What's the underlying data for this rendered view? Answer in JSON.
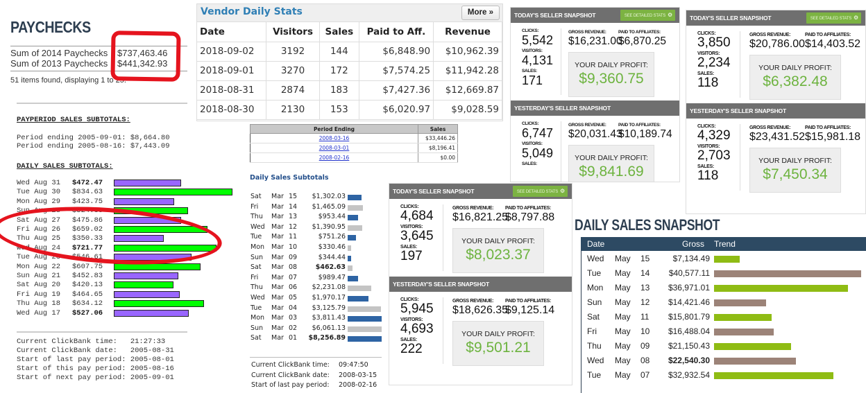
{
  "paychecks": {
    "title": "PAYCHECKS",
    "sums": [
      {
        "label": "Sum of 2014 Paychecks",
        "value": "$737,463.46"
      },
      {
        "label": "Sum of 2013 Paychecks",
        "value": "$441,342.93"
      }
    ],
    "items_found": "51 items found, displaying 1 to 25."
  },
  "clickbank_2005": {
    "payperiod_header": "PAYPERIOD SALES SUBTOTALS:",
    "periods": [
      "Period ending 2005-09-01: $8,664.80",
      "Period ending 2005-08-16: $7,443.09"
    ],
    "daily_header": "DAILY SALES SUBTOTALS:",
    "daily": [
      {
        "label": "Wed Aug 31",
        "value": "$472.47",
        "amount": 472.47,
        "bold": true,
        "color": "#9966ff"
      },
      {
        "label": "Tue Aug 30",
        "value": "$834.63",
        "amount": 834.63,
        "bold": false,
        "color": "#00ff00"
      },
      {
        "label": "Mon Aug 29",
        "value": "$423.75",
        "amount": 423.75,
        "bold": false,
        "color": "#9966ff"
      },
      {
        "label": "Sun Aug 28",
        "value": "$524.33",
        "amount": 524.33,
        "bold": false,
        "color": "#00ff00"
      },
      {
        "label": "Sat Aug 27",
        "value": "$475.86",
        "amount": 475.86,
        "bold": false,
        "color": "#9966ff"
      },
      {
        "label": "Fri Aug 26",
        "value": "$659.02",
        "amount": 659.02,
        "bold": false,
        "color": "#00ff00"
      },
      {
        "label": "Thu Aug 25",
        "value": "$350.33",
        "amount": 350.33,
        "bold": false,
        "color": "#9966ff"
      },
      {
        "label": "Wed Aug 24",
        "value": "$721.77",
        "amount": 721.77,
        "bold": true,
        "color": "#00ff00"
      },
      {
        "label": "Tue Aug 23",
        "value": "$546.61",
        "amount": 546.61,
        "bold": false,
        "color": "#9966ff"
      },
      {
        "label": "Mon Aug 22",
        "value": "$607.75",
        "amount": 607.75,
        "bold": false,
        "color": "#00ff00"
      },
      {
        "label": "Sun Aug 21",
        "value": "$452.83",
        "amount": 452.83,
        "bold": false,
        "color": "#9966ff"
      },
      {
        "label": "Sat Aug 20",
        "value": "$420.13",
        "amount": 420.13,
        "bold": false,
        "color": "#00ff00"
      },
      {
        "label": "Fri Aug 19",
        "value": "$464.65",
        "amount": 464.65,
        "bold": false,
        "color": "#9966ff"
      },
      {
        "label": "Thu Aug 18",
        "value": "$634.12",
        "amount": 634.12,
        "bold": false,
        "color": "#00ff00"
      },
      {
        "label": "Wed Aug 17",
        "value": "$527.06",
        "amount": 527.06,
        "bold": true,
        "color": "#9966ff"
      }
    ],
    "info": [
      "Current ClickBank time:   21:27:33",
      "Current ClickBank date:   2005-08-31",
      "Start of last pay period: 2005-08-01",
      "Start of this pay period: 2005-08-16",
      "Start of next pay period: 2005-09-01"
    ]
  },
  "vendor_stats": {
    "title": "Vendor Daily Stats",
    "more_label": "More »",
    "columns": [
      "Date",
      "Visitors",
      "Sales",
      "Paid to Aff.",
      "Revenue"
    ],
    "rows": [
      [
        "2018-09-02",
        "3192",
        "144",
        "$6,848.90",
        "$10,962.39"
      ],
      [
        "2018-09-01",
        "3270",
        "172",
        "$7,574.25",
        "$11,942.28"
      ],
      [
        "2018-08-31",
        "2874",
        "183",
        "$7,427.36",
        "$12,669.87"
      ],
      [
        "2018-08-30",
        "2130",
        "153",
        "$6,020.97",
        "$9,028.59"
      ]
    ]
  },
  "period_table": {
    "columns": [
      "Period Ending",
      "Sales"
    ],
    "rows": [
      [
        "2008-03-16",
        "$33,446.26"
      ],
      [
        "2008-03-01",
        "$8,196.41"
      ],
      [
        "2008-02-16",
        "$0.00"
      ]
    ]
  },
  "clickbank_2008": {
    "title": "Daily Sales Subtotals",
    "daily": [
      {
        "day": "Sat",
        "mon": "Mar",
        "num": "15",
        "value": "$1,302.03",
        "amount": 1302.03,
        "bold": false,
        "color": "#2e64a4"
      },
      {
        "day": "Fri",
        "mon": "Mar",
        "num": "14",
        "value": "$1,465.09",
        "amount": 1465.09,
        "bold": false,
        "color": "#c4c4c4"
      },
      {
        "day": "Thu",
        "mon": "Mar",
        "num": "13",
        "value": "$953.44",
        "amount": 953.44,
        "bold": false,
        "color": "#2e64a4"
      },
      {
        "day": "Wed",
        "mon": "Mar",
        "num": "12",
        "value": "$1,390.95",
        "amount": 1390.95,
        "bold": false,
        "color": "#c4c4c4"
      },
      {
        "day": "Tue",
        "mon": "Mar",
        "num": "11",
        "value": "$751.26",
        "amount": 751.26,
        "bold": false,
        "color": "#2e64a4"
      },
      {
        "day": "Mon",
        "mon": "Mar",
        "num": "10",
        "value": "$330.46",
        "amount": 330.46,
        "bold": false,
        "color": "#c4c4c4"
      },
      {
        "day": "Sun",
        "mon": "Mar",
        "num": "09",
        "value": "$344.44",
        "amount": 344.44,
        "bold": false,
        "color": "#2e64a4"
      },
      {
        "day": "Sat",
        "mon": "Mar",
        "num": "08",
        "value": "$462.63",
        "amount": 462.63,
        "bold": true,
        "color": "#c4c4c4"
      },
      {
        "day": "Fri",
        "mon": "Mar",
        "num": "07",
        "value": "$989.47",
        "amount": 989.47,
        "bold": false,
        "color": "#2e64a4"
      },
      {
        "day": "Thu",
        "mon": "Mar",
        "num": "06",
        "value": "$2,231.08",
        "amount": 2231.08,
        "bold": false,
        "color": "#c4c4c4"
      },
      {
        "day": "Wed",
        "mon": "Mar",
        "num": "05",
        "value": "$1,970.17",
        "amount": 1970.17,
        "bold": false,
        "color": "#2e64a4"
      },
      {
        "day": "Tue",
        "mon": "Mar",
        "num": "04",
        "value": "$3,125.79",
        "amount": 3125.79,
        "bold": false,
        "color": "#c4c4c4"
      },
      {
        "day": "Mon",
        "mon": "Mar",
        "num": "03",
        "value": "$3,811.43",
        "amount": 3811.43,
        "bold": false,
        "color": "#2e64a4"
      },
      {
        "day": "Sun",
        "mon": "Mar",
        "num": "02",
        "value": "$6,061.13",
        "amount": 6061.13,
        "bold": false,
        "color": "#c4c4c4"
      },
      {
        "day": "Sat",
        "mon": "Mar",
        "num": "01",
        "value": "$8,256.89",
        "amount": 8256.89,
        "bold": true,
        "color": "#2e64a4"
      }
    ],
    "info": [
      {
        "key": "Current ClickBank time:",
        "value": "09:47:50"
      },
      {
        "key": "Current ClickBank date:",
        "value": "2008-03-15"
      },
      {
        "key": "Start of last pay period:",
        "value": "2008-02-16"
      }
    ]
  },
  "snapshots": {
    "see_detailed_label": "SEE DETAILED STATS",
    "labels": {
      "clicks": "CLICKS:",
      "visitors": "VISITORS:",
      "sales": "SALES:",
      "gross": "GROSS REVENUE:",
      "affiliates": "PAID TO AFFILIATES:",
      "profit": "YOUR DAILY PROFIT:"
    },
    "cards": [
      {
        "today": {
          "title": "TODAY'S SELLER SNAPSHOT",
          "clicks": "5,542",
          "visitors": "4,131",
          "sales": "171",
          "gross": "$16,231.00",
          "affiliates": "$6,870.25",
          "profit": "$9,360.75"
        },
        "yesterday": {
          "title": "YESTERDAY'S SELLER SNAPSHOT",
          "clicks": "6,747",
          "visitors": "5,049",
          "sales": "",
          "gross": "$20,031.43",
          "affiliates": "$10,189.74",
          "profit": "$9,841.69"
        }
      },
      {
        "today": {
          "title": "TODAY'S SELLER SNAPSHOT",
          "clicks": "3,850",
          "visitors": "2,234",
          "sales": "118",
          "gross": "$20,786.00",
          "affiliates": "$14,403.52",
          "profit": "$6,382.48"
        },
        "yesterday": {
          "title": "YESTERDAY'S SELLER SNAPSHOT",
          "clicks": "4,329",
          "visitors": "2,703",
          "sales": "118",
          "gross": "$23,431.52",
          "affiliates": "$15,981.18",
          "profit": "$7,450.34"
        }
      },
      {
        "today": {
          "title": "TODAY'S SELLER SNAPSHOT",
          "clicks": "4,684",
          "visitors": "3,645",
          "sales": "197",
          "gross": "$16,821.25",
          "affiliates": "$8,797.88",
          "profit": "$8,023.37"
        },
        "yesterday": {
          "title": "YESTERDAY'S SELLER SNAPSHOT",
          "clicks": "5,945",
          "visitors": "4,693",
          "sales": "222",
          "gross": "$18,626.35",
          "affiliates": "$9,125.14",
          "profit": "$9,501.21"
        }
      }
    ]
  },
  "may_snapshot": {
    "title": "DAILY SALES SNAPSHOT",
    "columns": [
      "Date",
      "Gross",
      "Trend"
    ],
    "rows": [
      {
        "day": "Wed",
        "mon": "May",
        "num": "15",
        "value": "$7,134.49",
        "amount": 7134.49,
        "bold": false,
        "color": "#8fbc14"
      },
      {
        "day": "Tue",
        "mon": "May",
        "num": "14",
        "value": "$40,577.11",
        "amount": 40577.11,
        "bold": false,
        "color": "#9c8378"
      },
      {
        "day": "Mon",
        "mon": "May",
        "num": "13",
        "value": "$36,971.01",
        "amount": 36971.01,
        "bold": false,
        "color": "#8fbc14"
      },
      {
        "day": "Sun",
        "mon": "May",
        "num": "12",
        "value": "$14,421.46",
        "amount": 14421.46,
        "bold": false,
        "color": "#9c8378"
      },
      {
        "day": "Sat",
        "mon": "May",
        "num": "11",
        "value": "$15,801.79",
        "amount": 15801.79,
        "bold": false,
        "color": "#8fbc14"
      },
      {
        "day": "Fri",
        "mon": "May",
        "num": "10",
        "value": "$16,488.04",
        "amount": 16488.04,
        "bold": false,
        "color": "#9c8378"
      },
      {
        "day": "Thu",
        "mon": "May",
        "num": "09",
        "value": "$21,150.43",
        "amount": 21150.43,
        "bold": false,
        "color": "#8fbc14"
      },
      {
        "day": "Wed",
        "mon": "May",
        "num": "08",
        "value": "$22,540.30",
        "amount": 22540.3,
        "bold": true,
        "color": "#9c8378"
      },
      {
        "day": "Tue",
        "mon": "May",
        "num": "07",
        "value": "$32,932.54",
        "amount": 32932.54,
        "bold": false,
        "color": "#8fbc14"
      }
    ]
  }
}
